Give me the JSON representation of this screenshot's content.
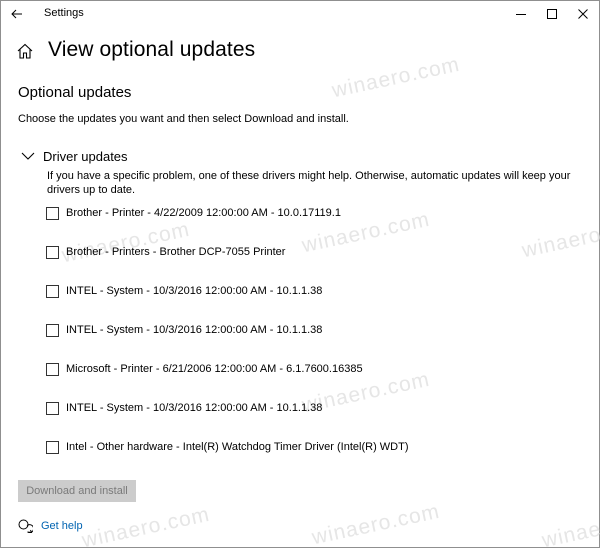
{
  "window": {
    "app_title": "Settings"
  },
  "header": {
    "page_title": "View optional updates",
    "home_icon": "home-icon"
  },
  "section": {
    "title": "Optional updates",
    "intro": "Choose the updates you want and then select Download and install."
  },
  "group": {
    "title": "Driver updates",
    "expanded": true,
    "description": "If you have a specific problem, one of these drivers might help. Otherwise, automatic updates will keep your drivers up to date.",
    "items": [
      {
        "label": "Brother - Printer - 4/22/2009 12:00:00 AM - 10.0.17119.1",
        "checked": false
      },
      {
        "label": "Brother - Printers - Brother DCP-7055 Printer",
        "checked": false
      },
      {
        "label": "INTEL - System - 10/3/2016 12:00:00 AM - 10.1.1.38",
        "checked": false
      },
      {
        "label": "INTEL - System - 10/3/2016 12:00:00 AM - 10.1.1.38",
        "checked": false
      },
      {
        "label": "Microsoft - Printer - 6/21/2006 12:00:00 AM - 6.1.7600.16385",
        "checked": false
      },
      {
        "label": "INTEL - System - 10/3/2016 12:00:00 AM - 10.1.1.38",
        "checked": false
      },
      {
        "label": "Intel - Other hardware - Intel(R) Watchdog Timer Driver (Intel(R) WDT)",
        "checked": false
      }
    ]
  },
  "actions": {
    "download_label": "Download and install",
    "download_enabled": false
  },
  "help": {
    "label": "Get help"
  },
  "watermark": {
    "text": "winaero.com"
  },
  "colors": {
    "link": "#0063b1",
    "button_disabled_bg": "#cccccc",
    "button_disabled_text": "#7a7a7a"
  }
}
